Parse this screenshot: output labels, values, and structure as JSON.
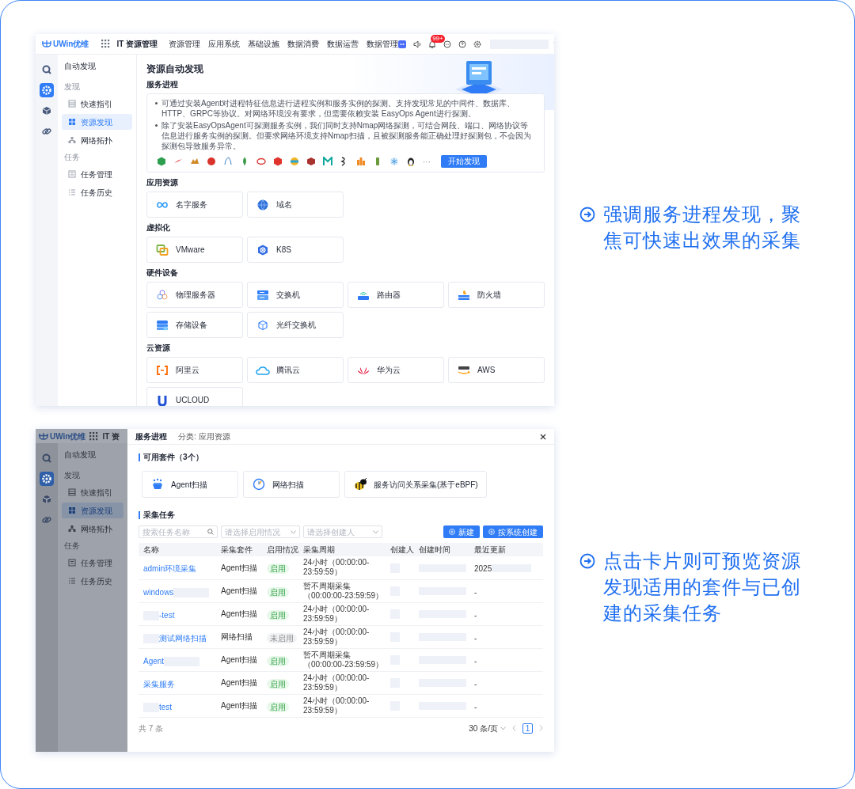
{
  "discovery_page": {
    "top_bar": {
      "logo": "UWin优维",
      "app_title": "IT 资源管理",
      "nav": [
        "资源管理",
        "应用系统",
        "基础设施",
        "数据消费",
        "数据运营",
        "数据管理"
      ],
      "notification_count": "99+"
    },
    "rail": [
      {
        "selected": false
      },
      {
        "selected": true
      },
      {
        "selected": false
      },
      {
        "selected": false
      }
    ],
    "sidebar": {
      "title": "自动发现",
      "groups": [
        {
          "label": "发现",
          "items": [
            {
              "label": "快速指引",
              "selected": false
            },
            {
              "label": "资源发现",
              "selected": true
            },
            {
              "label": "网络拓扑",
              "selected": false
            }
          ]
        },
        {
          "label": "任务",
          "items": [
            {
              "label": "任务管理",
              "selected": false
            },
            {
              "label": "任务历史",
              "selected": false
            }
          ]
        }
      ]
    },
    "page_title": "资源自动发现",
    "service_section": {
      "title": "服务进程",
      "bullets": [
        "可通过安装Agent对进程特征信息进行进程实例和服务实例的探测。支持发现常见的中间件、数据库、HTTP、GRPC等协议。对网络环境没有要求，但需要依赖安装 EasyOps Agent进行探测。",
        "除了安装EasyOpsAgent可探测服务实例，我们同时支持Nmap网络探测，可结合网段、端口、网络协议等信息进行服务实例的探测。但要求网络环境支持Nmap扫描，且被探测服务能正确处理好探测包，不会因为探测包导致服务异常。"
      ],
      "more": "···",
      "button": "开始发现"
    },
    "sections": [
      {
        "title": "应用资源",
        "cards": [
          "名字服务",
          "域名"
        ]
      },
      {
        "title": "虚拟化",
        "cards": [
          "VMware",
          "K8S"
        ]
      },
      {
        "title": "硬件设备",
        "cards": [
          "物理服务器",
          "交换机",
          "路由器",
          "防火墙",
          "存储设备",
          "光纤交换机"
        ]
      },
      {
        "title": "云资源",
        "cards": [
          "阿里云",
          "腾讯云",
          "华为云",
          "AWS",
          "UCLOUD"
        ]
      }
    ]
  },
  "suite_drawer": {
    "background": {
      "logo": "UWin优维",
      "app_title": "IT 资",
      "rail": [
        {
          "selected": false
        },
        {
          "selected": true
        },
        {
          "selected": false
        },
        {
          "selected": false
        }
      ],
      "sidebar": {
        "title": "自动发现",
        "groups": [
          {
            "label": "发现",
            "items": [
              {
                "label": "快速指引",
                "selected": false
              },
              {
                "label": "资源发现",
                "selected": true
              },
              {
                "label": "网络拓扑",
                "selected": false
              }
            ]
          },
          {
            "label": "任务",
            "items": [
              {
                "label": "任务管理",
                "selected": false
              },
              {
                "label": "任务历史",
                "selected": false
              }
            ]
          }
        ]
      }
    },
    "title": "服务进程",
    "category": "分类: 应用资源",
    "suites_title": "可用套件（3个）",
    "suites": [
      "Agent扫描",
      "网络扫描",
      "服务访问关系采集(基于eBPF)"
    ],
    "tasks_title": "采集任务",
    "filters": [
      {
        "kind": "search",
        "placeholder": "搜索任务名称"
      },
      {
        "kind": "select",
        "placeholder": "请选择启用情况"
      },
      {
        "kind": "select",
        "placeholder": "请选择创建人"
      }
    ],
    "buttons": [
      "新建",
      "按系统创建"
    ],
    "table": {
      "columns": [
        "名称",
        "采集套件",
        "启用情况",
        "采集周期",
        "创建人",
        "创建时间",
        "最近更新"
      ],
      "rows": [
        {
          "name": "admin环境采集",
          "name_prefix_hidden": false,
          "name_suffix_hidden": false,
          "suite": "Agent扫描",
          "status": "启用",
          "enabled": true,
          "period": [
            "24小时（00:00:00-",
            "23:59:59）"
          ],
          "last_update": "2025",
          "last_update_redacted": true
        },
        {
          "name": "windows",
          "name_prefix_hidden": false,
          "name_suffix_hidden": true,
          "suite": "Agent扫描",
          "status": "启用",
          "enabled": true,
          "period": [
            "暂不周期采集",
            "（00:00:00-23:59:59）"
          ],
          "last_update": "-",
          "last_update_redacted": false
        },
        {
          "name": "-test",
          "name_prefix_hidden": true,
          "name_suffix_hidden": false,
          "suite": "Agent扫描",
          "status": "启用",
          "enabled": true,
          "period": [
            "24小时（00:00:00-",
            "23:59:59）"
          ],
          "last_update": "-",
          "last_update_redacted": false
        },
        {
          "name": "测试网络扫描",
          "name_prefix_hidden": true,
          "name_suffix_hidden": false,
          "suite": "网络扫描",
          "status": "未启用",
          "enabled": false,
          "period": [
            "24小时（00:00:00-",
            "23:59:59）"
          ],
          "last_update": "-",
          "last_update_redacted": false
        },
        {
          "name": "Agent",
          "name_prefix_hidden": false,
          "name_suffix_hidden": true,
          "suite": "Agent扫描",
          "status": "启用",
          "enabled": true,
          "period": [
            "暂不周期采集",
            "（00:00:00-23:59:59）"
          ],
          "last_update": "-",
          "last_update_redacted": false
        },
        {
          "name": "采集服务",
          "name_prefix_hidden": false,
          "name_suffix_hidden": false,
          "suite": "Agent扫描",
          "status": "启用",
          "enabled": true,
          "period": [
            "24小时（00:00:00-",
            "23:59:59）"
          ],
          "last_update": "-",
          "last_update_redacted": false
        },
        {
          "name": "test",
          "name_prefix_hidden": true,
          "name_suffix_hidden": false,
          "suite": "Agent扫描",
          "status": "启用",
          "enabled": true,
          "period": [
            "24小时（00:00:00-",
            "23:59:59）"
          ],
          "last_update": "-",
          "last_update_redacted": false
        }
      ]
    },
    "total": "共 7 条",
    "page_size": "30 条/页",
    "page": "1"
  },
  "callouts": [
    "强调服务进程发现，聚焦可快速出效果的采集",
    "点击卡片则可预览资源发现适用的套件与已创建的采集任务"
  ]
}
